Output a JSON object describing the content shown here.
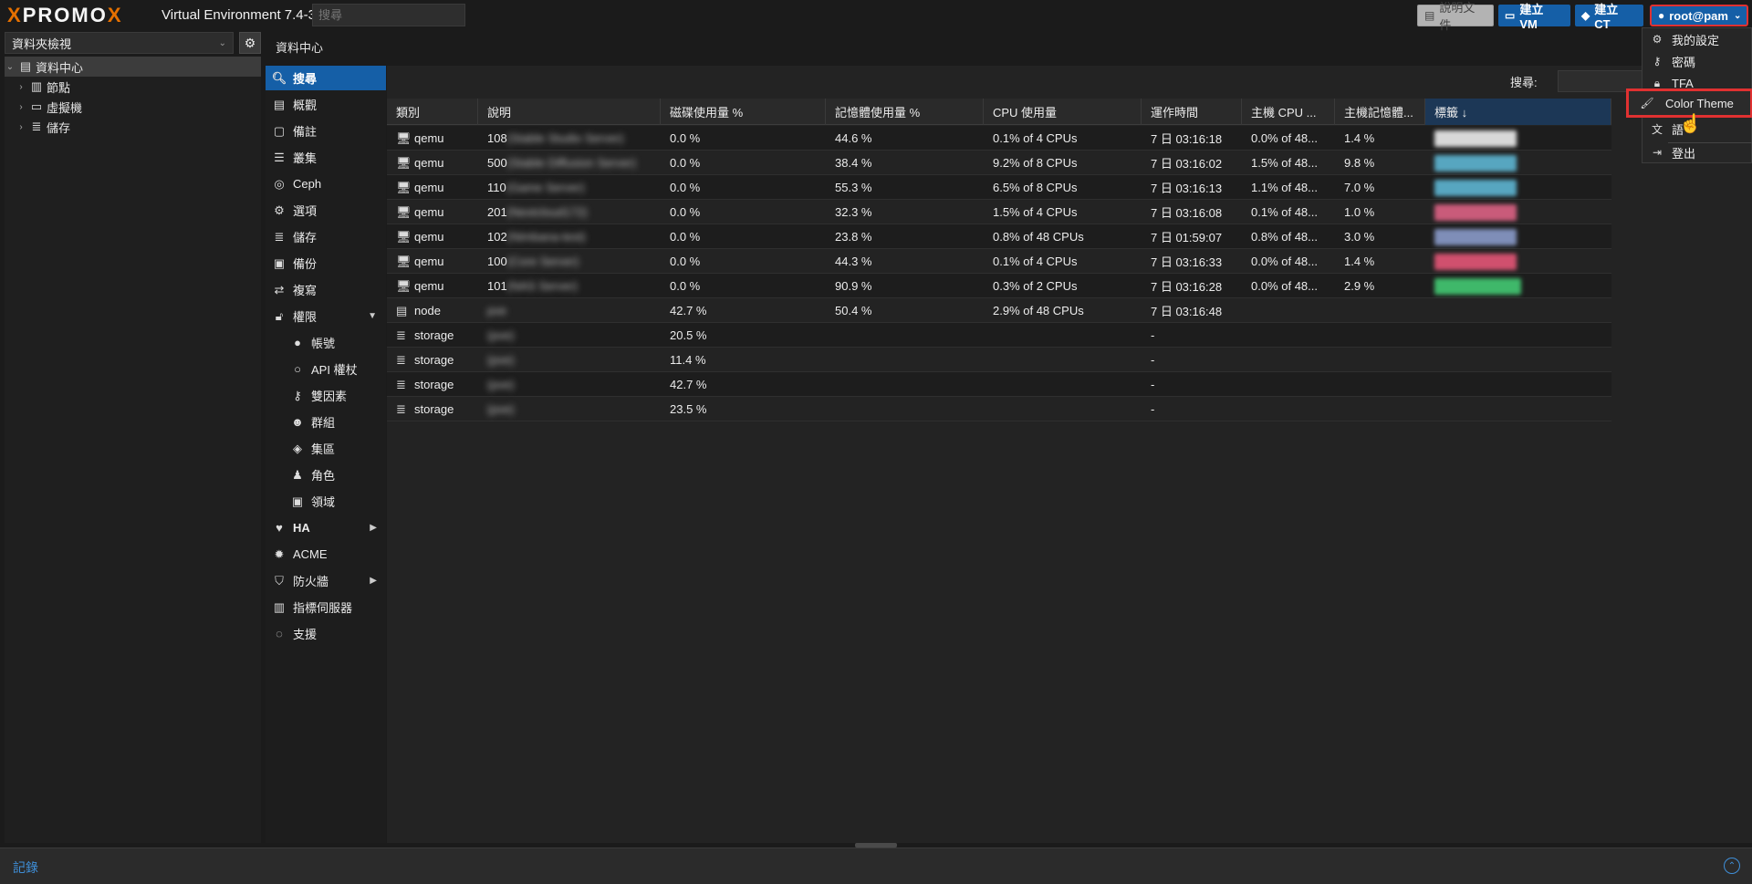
{
  "header": {
    "logo_text_1": "PRO",
    "logo_text_x1": "X",
    "logo_text_2": "MO",
    "logo_text_x2": "X",
    "version": "Virtual Environment 7.4-3",
    "search_placeholder": "搜尋",
    "docs_label": "說明文件",
    "create_vm_label": "建立 VM",
    "create_ct_label": "建立 CT",
    "user_label": "root@pam"
  },
  "user_menu": {
    "items": [
      {
        "label": "我的設定",
        "icon": "gear-icon"
      },
      {
        "label": "密碼",
        "icon": "key-icon"
      },
      {
        "label": "TFA",
        "icon": "lock-icon"
      },
      {
        "label": "Color Theme",
        "icon": "paint-brush-icon"
      },
      {
        "label": "語",
        "icon": "language-icon"
      },
      {
        "label": "登出",
        "icon": "sign-out-icon"
      }
    ]
  },
  "tree": {
    "view_select": "資料夾檢視",
    "root": "資料中心",
    "children": [
      "節點",
      "虛擬機",
      "儲存"
    ]
  },
  "breadcrumb": "資料中心",
  "nav": {
    "items": [
      {
        "label": "搜尋",
        "icon": "search-icon",
        "active": true
      },
      {
        "label": "概觀",
        "icon": "book-icon"
      },
      {
        "label": "備註",
        "icon": "note-icon"
      },
      {
        "label": "叢集",
        "icon": "cluster-icon"
      },
      {
        "label": "Ceph",
        "icon": "ceph-icon"
      },
      {
        "label": "選項",
        "icon": "gear-icon"
      },
      {
        "label": "儲存",
        "icon": "database-icon"
      },
      {
        "label": "備份",
        "icon": "floppy-icon"
      },
      {
        "label": "複寫",
        "icon": "retweet-icon"
      },
      {
        "label": "權限",
        "icon": "unlock-icon",
        "expanded": true
      },
      {
        "label": "帳號",
        "icon": "user-icon",
        "sub": true
      },
      {
        "label": "API 權杖",
        "icon": "user-outline-icon",
        "sub": true
      },
      {
        "label": "雙因素",
        "icon": "key-icon",
        "sub": true
      },
      {
        "label": "群組",
        "icon": "users-icon",
        "sub": true
      },
      {
        "label": "集區",
        "icon": "tags-icon",
        "sub": true
      },
      {
        "label": "角色",
        "icon": "male-icon",
        "sub": true
      },
      {
        "label": "領域",
        "icon": "address-book-icon",
        "sub": true
      },
      {
        "label": "HA",
        "icon": "heartbeat-icon",
        "collapsed": true
      },
      {
        "label": "ACME",
        "icon": "certificate-icon"
      },
      {
        "label": "防火牆",
        "icon": "shield-icon",
        "collapsed": true
      },
      {
        "label": "指標伺服器",
        "icon": "bar-chart-icon"
      },
      {
        "label": "支援",
        "icon": "comments-icon"
      }
    ]
  },
  "search": {
    "label": "搜尋:"
  },
  "grid": {
    "columns": [
      "類別",
      "說明",
      "磁碟使用量 %",
      "記憶體使用量 %",
      "CPU 使用量",
      "運作時間",
      "主機 CPU ...",
      "主機記憶體...",
      "標籤 ↓"
    ],
    "rows": [
      {
        "type": "qemu",
        "id": "108",
        "name": "(Stable Studio Server)",
        "disk": "0.0 %",
        "mem": "44.6 %",
        "cpu": "0.1% of 4 CPUs",
        "uptime": "7 日 03:16:18",
        "hcpu": "0.0% of 48...",
        "hmem": "1.4 %",
        "tag": "#d8d8d8"
      },
      {
        "type": "qemu",
        "id": "500",
        "name": "(Stable Diffusion Server)",
        "disk": "0.0 %",
        "mem": "38.4 %",
        "cpu": "9.2% of 8 CPUs",
        "uptime": "7 日 03:16:02",
        "hcpu": "1.5% of 48...",
        "hmem": "9.8 %",
        "tag": "#57a6c0"
      },
      {
        "type": "qemu",
        "id": "110",
        "name": "(Game Server)",
        "disk": "0.0 %",
        "mem": "55.3 %",
        "cpu": "6.5% of 8 CPUs",
        "uptime": "7 日 03:16:13",
        "hcpu": "1.1% of 48...",
        "hmem": "7.0 %",
        "tag": "#57a6c0"
      },
      {
        "type": "qemu",
        "id": "201",
        "name": "(Nextcloud172)",
        "disk": "0.0 %",
        "mem": "32.3 %",
        "cpu": "1.5% of 4 CPUs",
        "uptime": "7 日 03:16:08",
        "hcpu": "0.1% of 48...",
        "hmem": "1.0 %",
        "tag": "#c95b7a"
      },
      {
        "type": "qemu",
        "id": "102",
        "name": "(Nimbana-test)",
        "disk": "0.0 %",
        "mem": "23.8 %",
        "cpu": "0.8% of 48 CPUs",
        "uptime": "7 日 01:59:07",
        "hcpu": "0.8% of 48...",
        "hmem": "3.0 %",
        "tag": "#7f8eb8"
      },
      {
        "type": "qemu",
        "id": "100",
        "name": "(Core Server)",
        "disk": "0.0 %",
        "mem": "44.3 %",
        "cpu": "0.1% of 4 CPUs",
        "uptime": "7 日 03:16:33",
        "hcpu": "0.0% of 48...",
        "hmem": "1.4 %",
        "tag": "#d0506e"
      },
      {
        "type": "qemu",
        "id": "101",
        "name": "(NAS Server)",
        "disk": "0.0 %",
        "mem": "90.9 %",
        "cpu": "0.3% of 2 CPUs",
        "uptime": "7 日 03:16:28",
        "hcpu": "0.0% of 48...",
        "hmem": "2.9 %",
        "tag": "#3fb86a"
      },
      {
        "type": "node",
        "id": "",
        "name": "pve",
        "disk": "42.7 %",
        "mem": "50.4 %",
        "cpu": "2.9% of 48 CPUs",
        "uptime": "7 日 03:16:48",
        "hcpu": "",
        "hmem": "",
        "tag": ""
      },
      {
        "type": "storage",
        "id": "",
        "name": "(pve)",
        "disk": "20.5 %",
        "mem": "",
        "cpu": "",
        "uptime": "-",
        "hcpu": "",
        "hmem": "",
        "tag": ""
      },
      {
        "type": "storage",
        "id": "",
        "name": "(pve)",
        "disk": "11.4 %",
        "mem": "",
        "cpu": "",
        "uptime": "-",
        "hcpu": "",
        "hmem": "",
        "tag": ""
      },
      {
        "type": "storage",
        "id": "",
        "name": "(pve)",
        "disk": "42.7 %",
        "mem": "",
        "cpu": "",
        "uptime": "-",
        "hcpu": "",
        "hmem": "",
        "tag": ""
      },
      {
        "type": "storage",
        "id": "",
        "name": "(pve)",
        "disk": "23.5 %",
        "mem": "",
        "cpu": "",
        "uptime": "-",
        "hcpu": "",
        "hmem": "",
        "tag": ""
      }
    ]
  },
  "log": {
    "title": "記錄"
  },
  "colors": {
    "accent": "#155fa7",
    "highlight": "#e03131",
    "logo_orange": "#e57000"
  }
}
